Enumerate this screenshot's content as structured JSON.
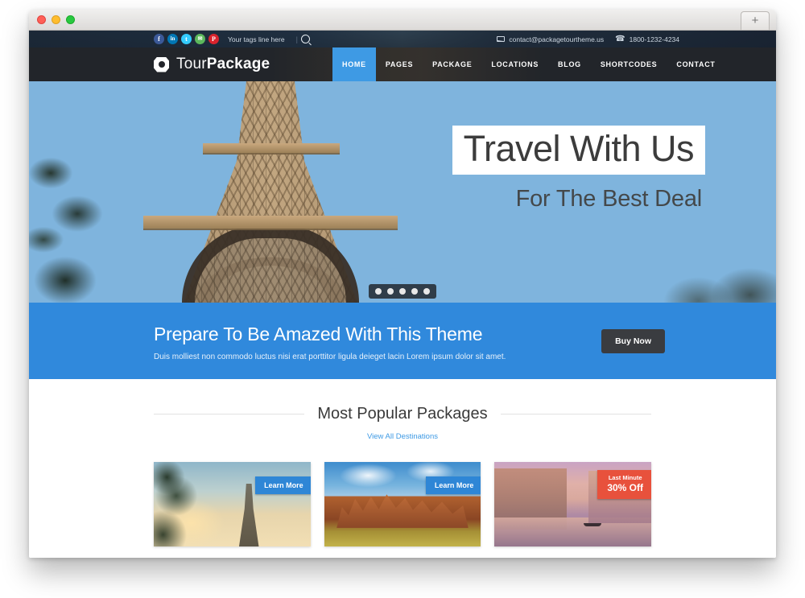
{
  "browser": {
    "new_tab_label": "+",
    "traffic_lights": [
      "close",
      "minimize",
      "maximize"
    ]
  },
  "topbar": {
    "social": [
      {
        "name": "facebook-icon",
        "glyph": "f",
        "color": "#3b5998"
      },
      {
        "name": "linkedin-icon",
        "glyph": "in",
        "color": "#0077b5"
      },
      {
        "name": "twitter-icon",
        "glyph": "t",
        "color": "#33ccff"
      },
      {
        "name": "email-icon",
        "glyph": "✉",
        "color": "#5cb85c"
      },
      {
        "name": "pinterest-icon",
        "glyph": "P",
        "color": "#d9232d"
      }
    ],
    "tagline": "Your tags line here",
    "separator": "|",
    "search_icon": "search-icon",
    "email": "contact@packagetourtheme.us",
    "phone": "1800-1232-4234"
  },
  "header": {
    "logo": {
      "thin": "Tour",
      "bold": "Package",
      "mark": "camera-icon"
    },
    "nav": [
      {
        "label": "HOME",
        "active": true
      },
      {
        "label": "PAGES",
        "active": false
      },
      {
        "label": "PACKAGE",
        "active": false
      },
      {
        "label": "LOCATIONS",
        "active": false
      },
      {
        "label": "BLOG",
        "active": false
      },
      {
        "label": "SHORTCODES",
        "active": false
      },
      {
        "label": "CONTACT",
        "active": false
      }
    ]
  },
  "hero": {
    "title": "Travel With Us",
    "subtitle": "For The Best Deal",
    "slide_count": 5,
    "active_slide": 1,
    "image_alt": "eiffel-tower-paris"
  },
  "cta": {
    "heading": "Prepare To Be Amazed With This Theme",
    "paragraph": "Duis molliest non commodo luctus nisi erat porttitor ligula deieget lacin Lorem ipsum dolor sit amet.",
    "button_label": "Buy Now",
    "background_color": "#3089dc",
    "button_color": "#3a3c40"
  },
  "packages": {
    "section_title": "Most Popular Packages",
    "view_all_link": "View All Destinations",
    "link_color": "#3e9ae4",
    "cards": [
      {
        "image_alt": "eiffel-tower-sunset",
        "badge_type": "learn-more",
        "badge_label": "Learn More",
        "badge_color": "#2e86d6"
      },
      {
        "image_alt": "red-rock-canyon",
        "badge_type": "learn-more",
        "badge_label": "Learn More",
        "badge_color": "#2e86d6"
      },
      {
        "image_alt": "venice-canal-gondola",
        "badge_type": "last-minute",
        "badge_line1": "Last Minute",
        "badge_line2": "30% Off",
        "badge_color": "#e8513c"
      }
    ]
  }
}
